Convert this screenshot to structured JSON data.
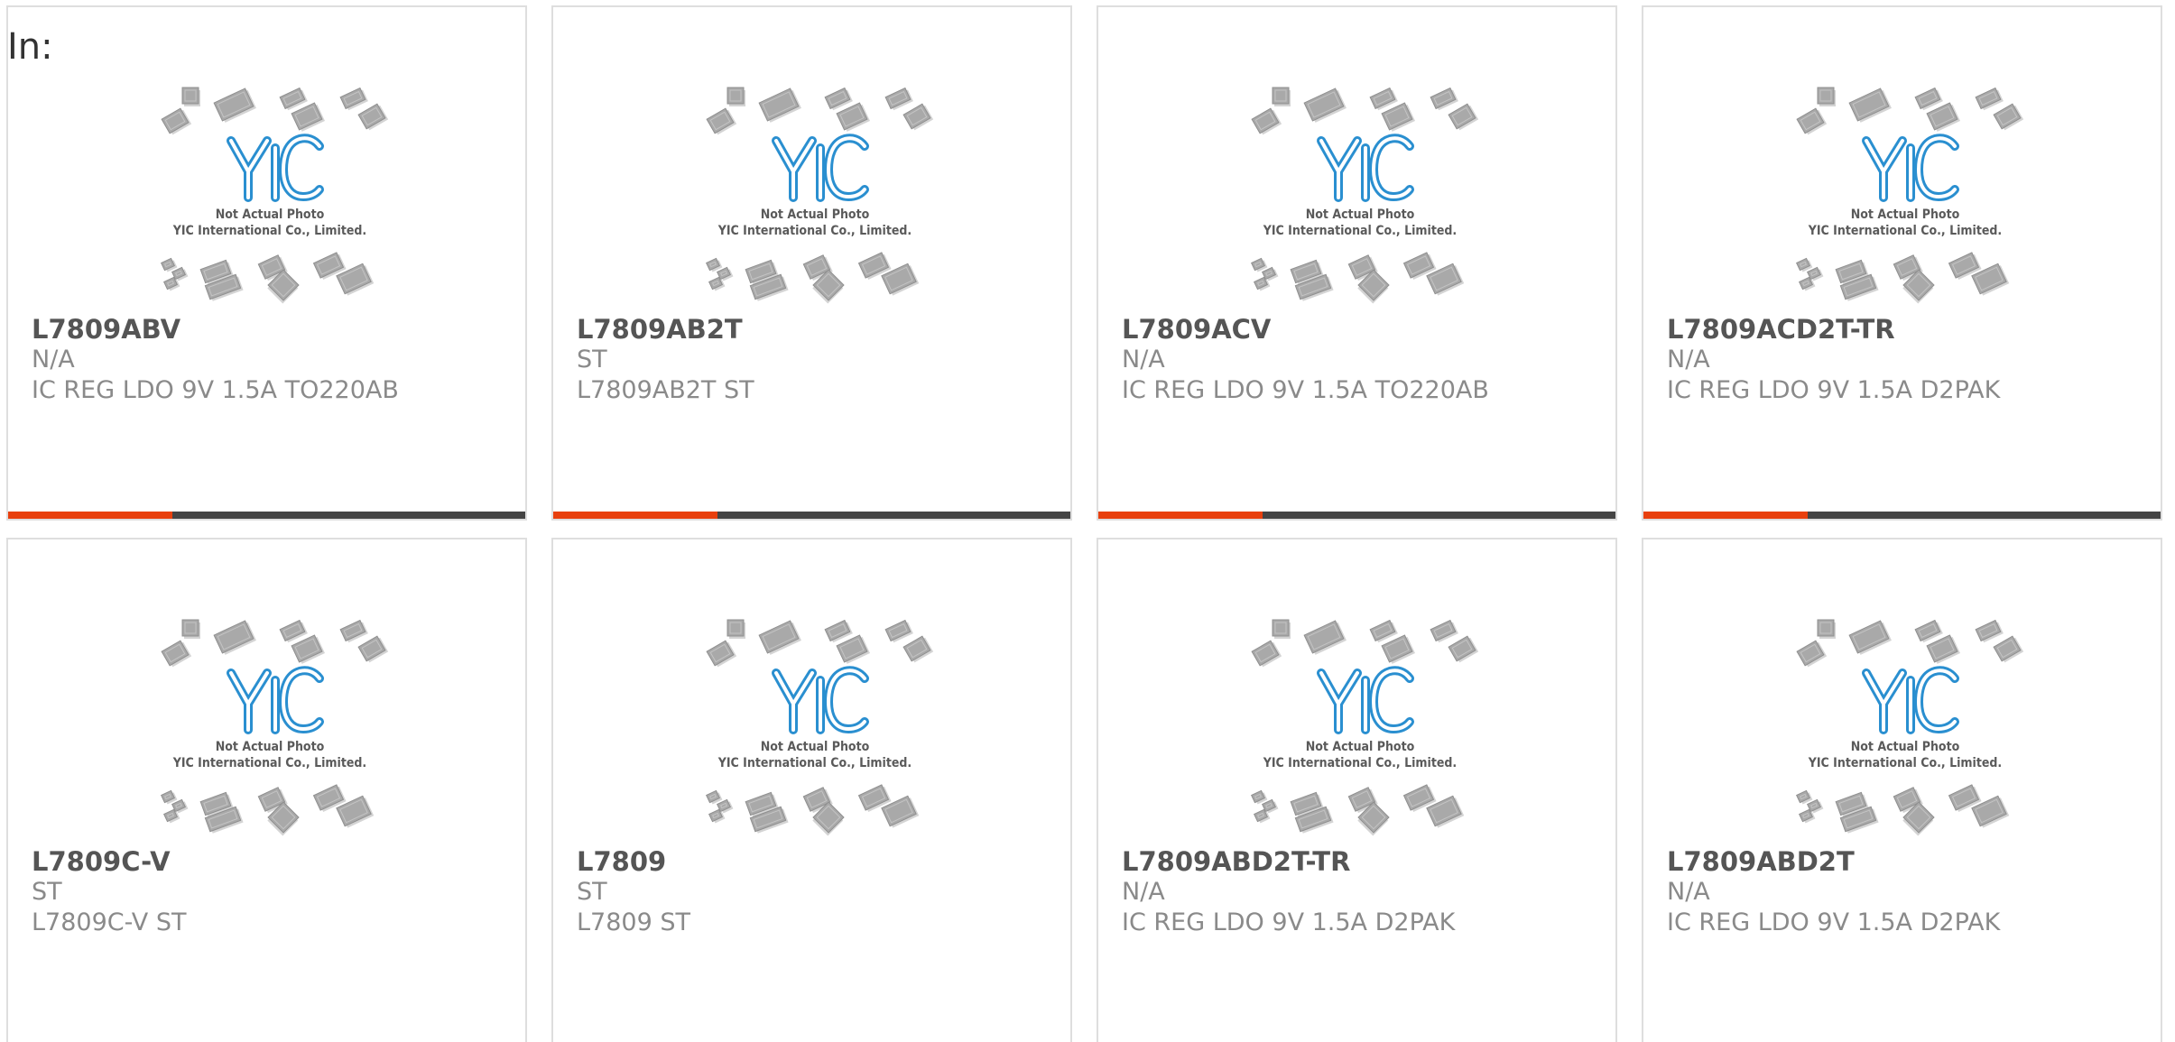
{
  "header": {
    "label": "In:"
  },
  "placeholder": {
    "logo_text": "YIC",
    "caption_line1": "Not Actual Photo",
    "caption_line2": "YIC International Co., Limited."
  },
  "colors": {
    "accent": "#e8400e",
    "bar": "#444444",
    "logo_blue": "#2a8fd0",
    "chip_gray": "#a9a9a9"
  },
  "products": [
    {
      "part": "L7809ABV",
      "maker": "N/A",
      "desc": "IC REG LDO 9V 1.5A TO220AB"
    },
    {
      "part": "L7809AB2T",
      "maker": "ST",
      "desc": "L7809AB2T ST"
    },
    {
      "part": "L7809ACV",
      "maker": "N/A",
      "desc": "IC REG LDO 9V 1.5A TO220AB"
    },
    {
      "part": "L7809ACD2T-TR",
      "maker": "N/A",
      "desc": "IC REG LDO 9V 1.5A D2PAK"
    },
    {
      "part": "L7809C-V",
      "maker": "ST",
      "desc": "L7809C-V ST"
    },
    {
      "part": "L7809",
      "maker": "ST",
      "desc": "L7809 ST"
    },
    {
      "part": "L7809ABD2T-TR",
      "maker": "N/A",
      "desc": "IC REG LDO 9V 1.5A D2PAK"
    },
    {
      "part": "L7809ABD2T",
      "maker": "N/A",
      "desc": "IC REG LDO 9V 1.5A D2PAK"
    }
  ]
}
